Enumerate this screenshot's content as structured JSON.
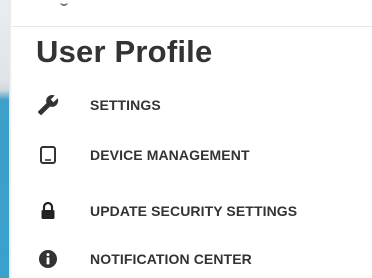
{
  "page": {
    "title": "User Profile"
  },
  "menu": {
    "items": [
      {
        "label": "SETTINGS",
        "icon": "wrench-icon"
      },
      {
        "label": "DEVICE MANAGEMENT",
        "icon": "tablet-icon"
      },
      {
        "label": "UPDATE SECURITY SETTINGS",
        "icon": "lock-icon"
      },
      {
        "label": "NOTIFICATION CENTER",
        "icon": "info-icon"
      }
    ]
  },
  "colors": {
    "text": "#333333",
    "background": "#ffffff",
    "side_accent": "#3aa0cc"
  }
}
